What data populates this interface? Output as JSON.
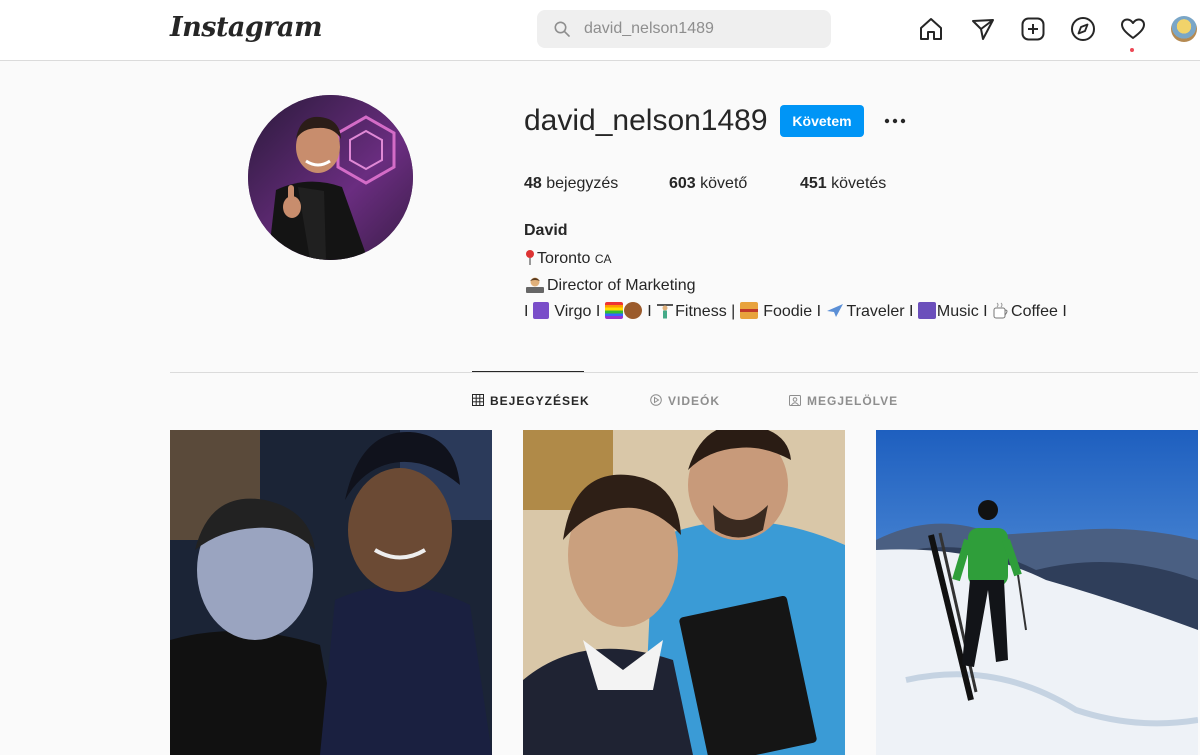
{
  "nav": {
    "logo": "Instagram",
    "search_value": "david_nelson1489",
    "icons": [
      "home-icon",
      "direct-icon",
      "new-post-icon",
      "explore-icon",
      "activity-icon",
      "profile-avatar"
    ]
  },
  "profile": {
    "username": "david_nelson1489",
    "follow_label": "Követem",
    "stats": {
      "posts_count": "48",
      "posts_label": "bejegyzés",
      "followers_count": "603",
      "followers_label": "követő",
      "following_count": "451",
      "following_label": "követés"
    },
    "full_name": "David",
    "bio": {
      "line1_text": "Toronto",
      "line1_suffix": "CA",
      "line2_text": "Director of Marketing",
      "line3": {
        "p1": "I",
        "virgo": "Virgo I",
        "sep1": "I",
        "fitness": "Fitness |",
        "foodie": "Foodie I",
        "traveler": "Traveler I",
        "music": "Music I",
        "coffee": "Coffee I"
      }
    }
  },
  "tabs": [
    {
      "label": "BEJEGYZÉSEK",
      "active": true
    },
    {
      "label": "VIDEÓK",
      "active": false
    },
    {
      "label": "MEGJELÖLVE",
      "active": false
    }
  ],
  "colors": {
    "accent": "#0095f6",
    "notification": "#ed4956",
    "text": "#262626",
    "muted": "#8e8e8e"
  }
}
